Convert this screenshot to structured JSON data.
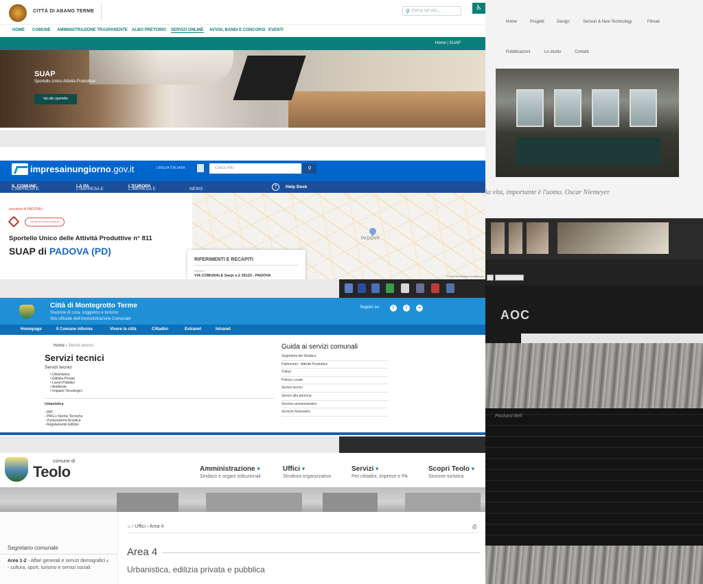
{
  "abano": {
    "city_name": "CITTÀ DI ABANO TERME",
    "search_placeholder": "Cerca nel sito...",
    "nav": [
      "HOME",
      "COMUNE",
      "AMMINISTRAZIONE TRASPARENTE",
      "ALBO PRETORIO",
      "SERVIZI ONLINE",
      "AVVISI, BANDI E CONCORSI",
      "EVENTI"
    ],
    "breadcrumb": "Home   |   SUAP",
    "hero_title": "SUAP",
    "hero_subtitle": "Sportello Unico Attività Produttive",
    "hero_button": "Vai allo sportello",
    "icons": [
      "crest-icon",
      "search-icon",
      "accessibility-icon"
    ],
    "accent_color": "#0a7e7a"
  },
  "impresa": {
    "logo_bold": "impresainungiorno",
    "logo_rest": ".gov.it",
    "tools_label": "LINGUA ITALIANA",
    "search_placeholder": "Cerca info",
    "nav": [
      {
        "pre": "L'IMPRESA E ",
        "bold": "IL COMUNE"
      },
      {
        "pre": "L'IMPRESA E ",
        "bold": "LA PA"
      },
      {
        "pre": "L'IMPRESA E ",
        "bold": "L'EUROPA"
      },
      {
        "pre": "NEWS",
        "bold": ""
      }
    ],
    "help_desk": "Help Desk",
    "province_link": "provincia di PADOVA »",
    "chamber_logo_text": "Camera di Commercio Padova",
    "heading_main": "Sportello Unico delle Attività Produttive n° 811",
    "heading_suap_prefix": "SUAP di ",
    "heading_suap_city": "PADOVA (PD)",
    "map_label": "PADOVA",
    "map_copyright": "© OpenStreetMap contributors",
    "card_title": "RIFERIMENTI E RECAPITI",
    "card_label": "Indirizzo",
    "card_address": "VIA COMUNALE Sarpi n.2 35123 - PADOVA",
    "accent_color": "#0066cc"
  },
  "montegrotto": {
    "title": "Città di Montegrotto Terme",
    "tagline1": "Stazione di cura, soggiorno e turismo",
    "tagline2": "Sito ufficiale dell'Amministrazione Comunale",
    "follow_label": "Seguici su:",
    "nav": [
      "Homepage",
      "Il Comune informa",
      "Vivere la città",
      "Cittadini",
      "Extranet",
      "Intranet"
    ],
    "breadcrumb_home": "Home",
    "breadcrumb_current": "Servizi tecnici",
    "page_title": "Servizi tecnici",
    "section_label": "Servizi tecnici",
    "services": [
      "Urbanistica",
      "Edilizia Privata",
      "Lavori Pubblici",
      "Ambiente",
      "Impianti Tecnologici"
    ],
    "subsection_label": "Urbanistica",
    "urban_items": [
      "PAT",
      "PRG e Norme Tecniche",
      "Zonizzazione Acustica",
      "Regolamento Edilizio"
    ],
    "guide_title": "Guida ai servizi comunali",
    "guide_items": [
      "Segreteria del Sindaco",
      "Patrimonio - Attività Produttive",
      "Tributi",
      "Polizia Locale",
      "Servizi tecnici",
      "Servizi alla persona",
      "Servizio amministrativo",
      "Servizio finanziario"
    ],
    "accent_color": "#1f8fd6"
  },
  "teolo": {
    "comune_di": "comune di",
    "name": "Teolo",
    "menu": [
      {
        "label": "Amministrazione",
        "sub": "Sindaco e organi istituzionali"
      },
      {
        "label": "Uffici",
        "sub": "Struttura organizzativa"
      },
      {
        "label": "Servizi",
        "sub": "Per cittadini, imprese e PA"
      },
      {
        "label": "Scopri Teolo",
        "sub": "Sezione turistica"
      }
    ],
    "sidebar_title": "Segretario comunale",
    "sidebar_item_bold": "Area 1-2",
    "sidebar_item_rest": " - Affari generali e servizi demografici - cultura, sport, turismo e servizi sociali",
    "breadcrumb_1": "Uffici",
    "breadcrumb_2": "Area 4",
    "page_title": "Area 4",
    "page_subtitle": "Urbanistica, edilizia privata e pubblica"
  },
  "background": {
    "site_nav": [
      "Home",
      "Progetti",
      "Design",
      "Sensori & New Technology",
      "Filmati",
      "Pubblicazioni",
      "Lo studio",
      "Contatti"
    ],
    "quote": "la vita, importante è l'uomo. Oscar Niemeyer",
    "monitor_brand": "AOC",
    "keyboard_brand": "Packard Bell"
  }
}
